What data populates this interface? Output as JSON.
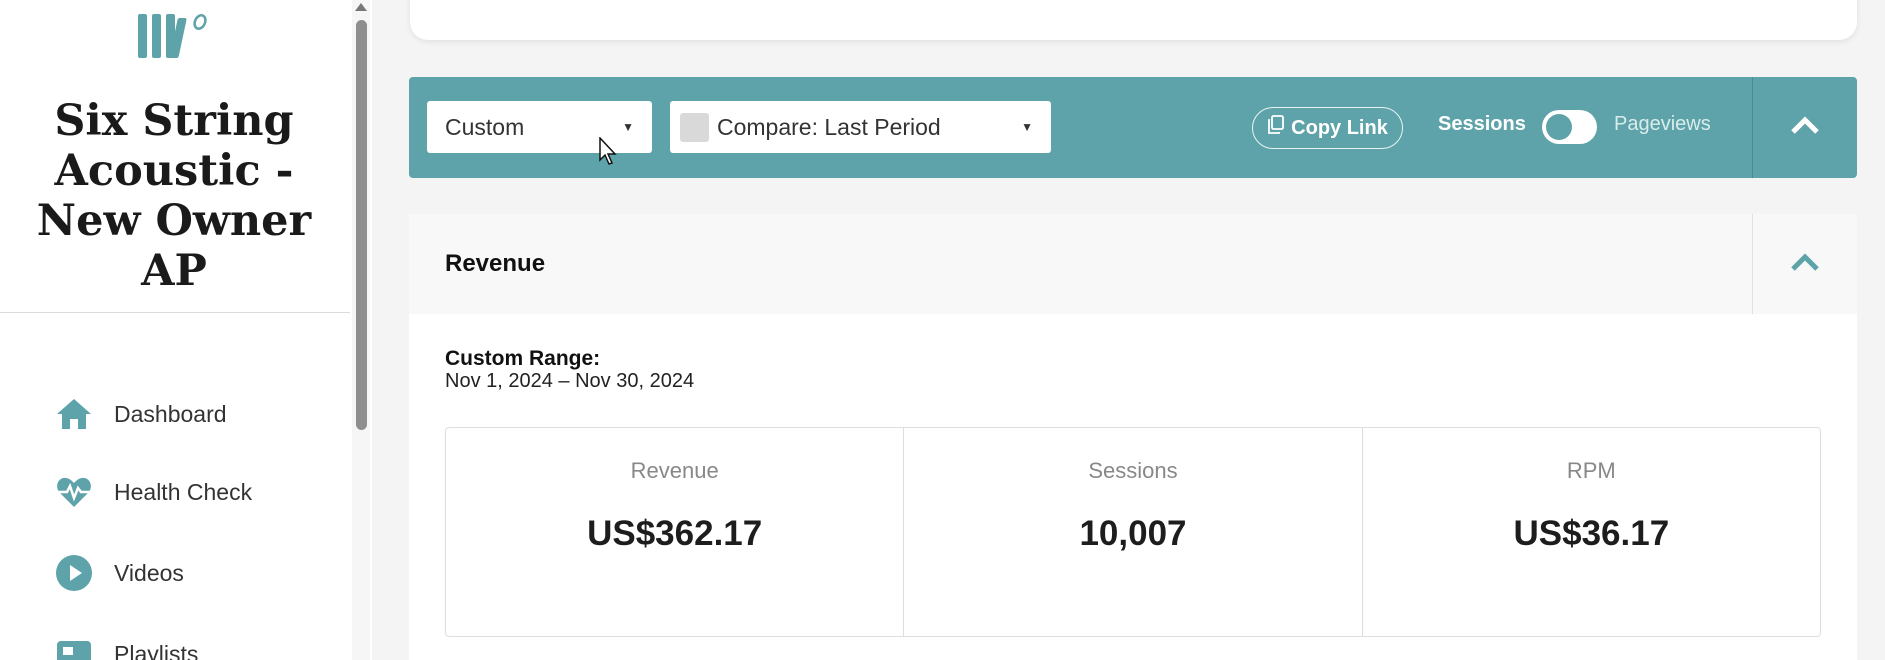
{
  "sidebar": {
    "site_name": "Six String Acoustic - New Owner AP",
    "nav": [
      {
        "label": "Dashboard",
        "icon": "home-icon"
      },
      {
        "label": "Health Check",
        "icon": "heartbeat-icon"
      },
      {
        "label": "Videos",
        "icon": "play-circle-icon"
      },
      {
        "label": "Playlists",
        "icon": "playlist-icon"
      }
    ]
  },
  "toolbar": {
    "date_select": "Custom",
    "compare_select": "Compare: Last Period",
    "copy_link": "Copy Link",
    "toggle_left": "Sessions",
    "toggle_right": "Pageviews"
  },
  "revenue": {
    "title": "Revenue",
    "range_label": "Custom Range:",
    "range_value": "Nov 1, 2024 – Nov 30, 2024",
    "stats": [
      {
        "label": "Revenue",
        "value": "US$362.17"
      },
      {
        "label": "Sessions",
        "value": "10,007"
      },
      {
        "label": "RPM",
        "value": "US$36.17"
      }
    ]
  },
  "colors": {
    "accent": "#5ea3a9",
    "text": "#1a1a1a"
  }
}
